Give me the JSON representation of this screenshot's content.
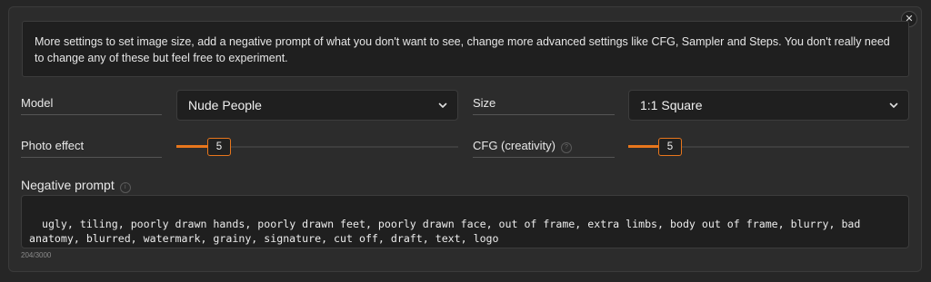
{
  "info_text": "More settings to set image size, add a negative prompt of what you don't want to see, change more advanced settings like CFG, Sampler and Steps. You don't really need to change any of these but feel free to experiment.",
  "model": {
    "label": "Model",
    "value": "Nude People"
  },
  "size": {
    "label": "Size",
    "value": "1:1 Square"
  },
  "photo_effect": {
    "label": "Photo effect",
    "value": "5",
    "fraction": 0.15
  },
  "cfg": {
    "label": "CFG (creativity)",
    "value": "5",
    "fraction": 0.15
  },
  "negative_prompt": {
    "label": "Negative prompt",
    "value": "ugly, tiling, poorly drawn hands, poorly drawn feet, poorly drawn face, out of frame, extra limbs, body out of frame, blurry, bad anatomy, blurred, watermark, grainy, signature, cut off, draft, text, logo",
    "counter": "204/3000"
  },
  "icons": {
    "close": "close-icon",
    "chevron": "chevron-down-icon",
    "info": "info-icon"
  },
  "colors": {
    "accent": "#e8761c",
    "background": "#262626",
    "input_bg": "#1f1f1f"
  }
}
